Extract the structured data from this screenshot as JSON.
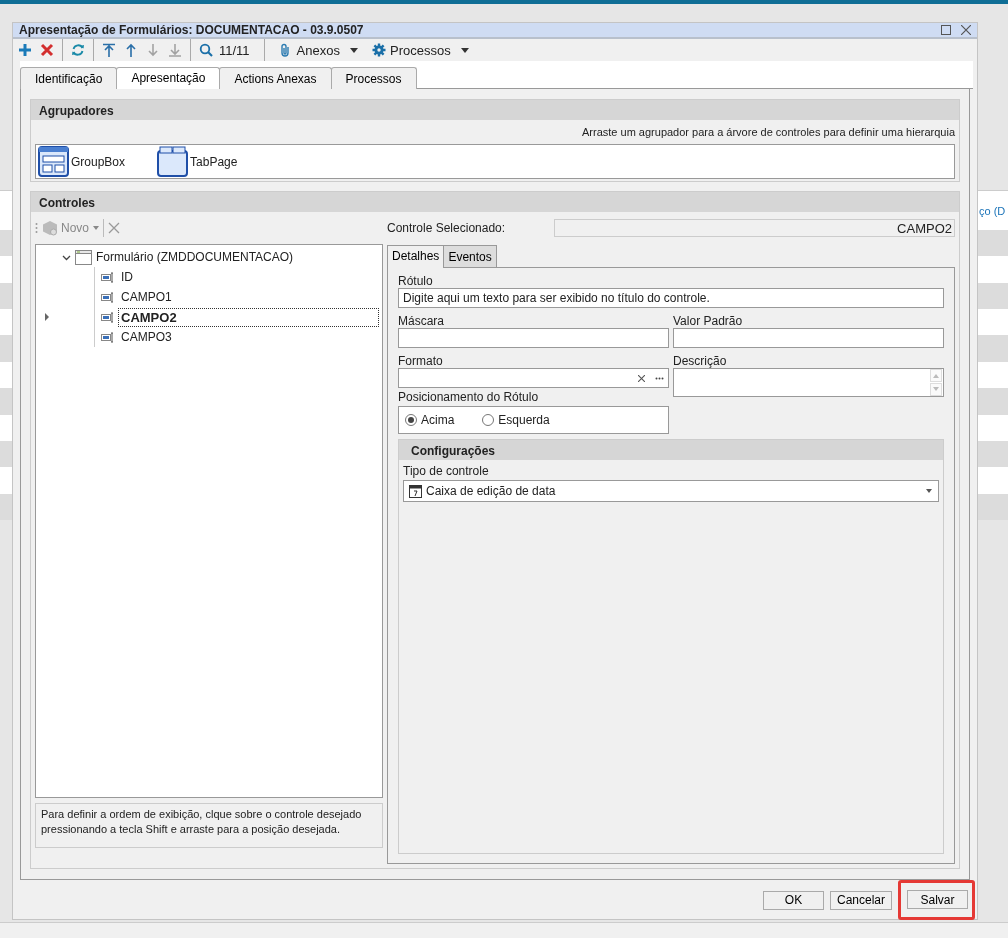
{
  "background": {
    "column_fragment": "ço (D"
  },
  "window": {
    "title": "Apresentação de Formulários: DOCUMENTACAO - 03.9.0507"
  },
  "toolbar": [
    {
      "kind": "button",
      "disabled": false
    },
    {
      "kind": "button",
      "disabled": false
    },
    {
      "kind": "separator"
    },
    {
      "kind": "button",
      "disabled": false
    },
    {
      "kind": "separator"
    },
    {
      "kind": "button",
      "disabled": false
    },
    {
      "kind": "button",
      "disabled": false
    },
    {
      "kind": "button",
      "disabled": true
    },
    {
      "kind": "button",
      "disabled": true
    },
    {
      "kind": "separator"
    },
    {
      "kind": "button",
      "disabled": false
    },
    {
      "kind": "counter",
      "text": "11/11"
    },
    {
      "kind": "separator"
    },
    {
      "kind": "menu",
      "label": "Anexos"
    },
    {
      "kind": "menu",
      "label": "Processos"
    }
  ],
  "tabs": [
    {
      "label": "Identificação",
      "selected": false
    },
    {
      "label": "Apresentação",
      "selected": true
    },
    {
      "label": "Actions Anexas",
      "selected": false
    },
    {
      "label": "Processos",
      "selected": false
    }
  ],
  "agrupadores": {
    "title": "Agrupadores",
    "hint": "Arraste um agrupador para a árvore de controles para definir uma hierarquia",
    "items": [
      {
        "label": "GroupBox"
      },
      {
        "label": "TabPage"
      }
    ]
  },
  "controles": {
    "title": "Controles",
    "toolbar": {
      "new_button": {
        "label": "Novo",
        "disabled": true
      },
      "delete_disabled": true
    },
    "tree": [
      {
        "label": "Formulário (ZMDDOCUMENTACAO)",
        "expanded": true,
        "children": [
          {
            "label": "ID",
            "selected": false
          },
          {
            "label": "CAMPO1",
            "selected": false
          },
          {
            "label": "CAMPO2",
            "selected": true
          },
          {
            "label": "CAMPO3",
            "selected": false
          }
        ]
      }
    ],
    "tree_hint": "Para definir a ordem de exibição, clque sobre o controle desejado pressionando a tecla Shift e arraste para a posição desejada.",
    "selected_control": {
      "label": "Controle Selecionado:",
      "value": "CAMPO2"
    },
    "detail_tabs": [
      {
        "label": "Detalhes",
        "selected": true
      },
      {
        "label": "Eventos",
        "selected": false
      }
    ],
    "fields": {
      "rotulo": {
        "label": "Rótulo",
        "value": "Digite aqui um texto para ser exibido no título do controle."
      },
      "mascara": {
        "label": "Máscara"
      },
      "valor_padrao": {
        "label": "Valor Padrão"
      },
      "formato": {
        "label": "Formato"
      },
      "descricao": {
        "label": "Descrição"
      }
    },
    "label_position": {
      "label": "Posicionamento do Rótulo",
      "options": [
        {
          "label": "Acima",
          "selected": true
        },
        {
          "label": "Esquerda",
          "selected": false
        }
      ]
    },
    "configuracoes": {
      "title": "Configurações",
      "control_type": {
        "label": "Tipo de controle",
        "value": "Caixa de edição de data"
      }
    }
  },
  "buttons": [
    {
      "label": "OK",
      "highlighted": false
    },
    {
      "label": "Cancelar",
      "highlighted": false
    },
    {
      "label": "Salvar",
      "highlighted": true
    }
  ]
}
